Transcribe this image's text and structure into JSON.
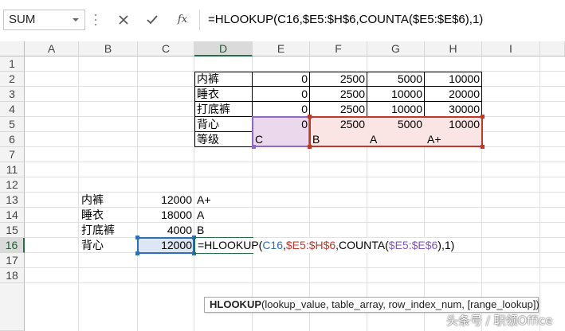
{
  "formula_bar": {
    "name_box": "SUM",
    "fx_label": "fx",
    "formula": "=HLOOKUP(C16,$E5:$H$6,COUNTA($E5:$E$6),1)"
  },
  "columns": [
    "A",
    "B",
    "C",
    "D",
    "E",
    "F",
    "G",
    "H",
    "I"
  ],
  "rows": [
    "1",
    "2",
    "3",
    "4",
    "5",
    "6",
    "7",
    "11",
    "12",
    "13",
    "14",
    "15",
    "16",
    "17",
    "18"
  ],
  "table": {
    "r2": {
      "label": "内裤",
      "e": "0",
      "f": "2500",
      "g": "5000",
      "h": "10000"
    },
    "r3": {
      "label": "睡衣",
      "e": "0",
      "f": "2500",
      "g": "10000",
      "h": "20000"
    },
    "r4": {
      "label": "打底裤",
      "e": "0",
      "f": "2500",
      "g": "10000",
      "h": "30000"
    },
    "r5": {
      "label": "背心",
      "e": "0",
      "f": "2500",
      "g": "5000",
      "h": "10000"
    },
    "r6": {
      "label": "等级",
      "e": "C",
      "f": "B",
      "g": "A",
      "h": "A+"
    }
  },
  "lookup": {
    "r13": {
      "b": "内裤",
      "c": "12000",
      "d": "A+"
    },
    "r14": {
      "b": "睡衣",
      "c": "18000",
      "d": "A"
    },
    "r15": {
      "b": "打底裤",
      "c": "4000",
      "d": "B"
    },
    "r16": {
      "b": "背心",
      "c": "12000"
    }
  },
  "editing": {
    "func": "=HLOOKUP(",
    "arg1": "C16",
    "comma1": ",",
    "arg2": "$E5:$H$6",
    "mid": ",COUNTA(",
    "arg3": "$E5:$E$6",
    "tail": "),1)"
  },
  "tooltip": {
    "func": "HLOOKUP",
    "args": "(lookup_value, table_array, row_index_num, [range_lookup])"
  },
  "watermark": "头条号 / 职领Office",
  "colors": {
    "header_bg": "#f3f3f3",
    "active_green": "#217346",
    "ref_blue": "#2f6fb5",
    "ref_red": "#c0392b",
    "ref_purple": "#7e57c2"
  }
}
